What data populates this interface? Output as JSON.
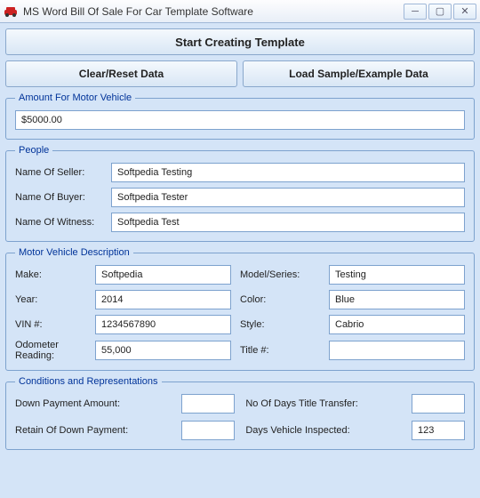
{
  "window": {
    "title": "MS Word Bill Of Sale For Car Template Software"
  },
  "buttons": {
    "start": "Start Creating Template",
    "clear": "Clear/Reset Data",
    "load": "Load Sample/Example Data"
  },
  "sections": {
    "amount": {
      "legend": "Amount For Motor Vehicle",
      "value": "$5000.00"
    },
    "people": {
      "legend": "People",
      "seller_label": "Name Of Seller:",
      "seller_value": "Softpedia Testing",
      "buyer_label": "Name Of Buyer:",
      "buyer_value": "Softpedia Tester",
      "witness_label": "Name Of Witness:",
      "witness_value": "Softpedia Test"
    },
    "vehicle": {
      "legend": "Motor Vehicle Description",
      "make_label": "Make:",
      "make_value": "Softpedia",
      "model_label": "Model/Series:",
      "model_value": "Testing",
      "year_label": "Year:",
      "year_value": "2014",
      "color_label": "Color:",
      "color_value": "Blue",
      "vin_label": "VIN #:",
      "vin_value": "1234567890",
      "style_label": "Style:",
      "style_value": "Cabrio",
      "odometer_label": "Odometer Reading:",
      "odometer_value": "55,000",
      "title_label": "Title #:",
      "title_value": ""
    },
    "conditions": {
      "legend": "Conditions and Representations",
      "down_payment_label": "Down Payment Amount:",
      "down_payment_value": "",
      "days_transfer_label": "No Of Days Title Transfer:",
      "days_transfer_value": "",
      "retain_label": "Retain Of Down Payment:",
      "retain_value": "",
      "days_inspected_label": "Days Vehicle Inspected:",
      "days_inspected_value": "123"
    }
  }
}
